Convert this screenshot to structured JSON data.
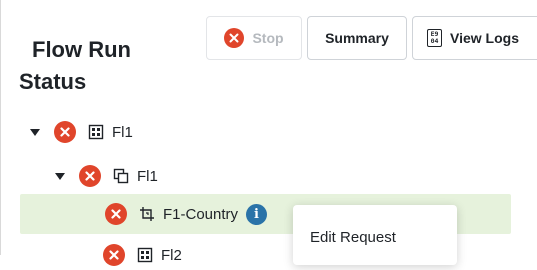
{
  "panel": {
    "title_line1": "Flow Run",
    "title_line2": "Status"
  },
  "toolbar": {
    "stop_label": "Stop",
    "summary_label": "Summary",
    "view_logs_label": "View Logs",
    "log_icon_text_top": "E9",
    "log_icon_text_bottom": "04"
  },
  "tree": {
    "nodes": [
      {
        "label": "Fl1",
        "icon": "grid-icon",
        "status": "error",
        "expanded": true
      },
      {
        "label": "Fl1",
        "icon": "copy-icon",
        "status": "error",
        "expanded": true
      },
      {
        "label": "F1-Country",
        "icon": "crop-icon",
        "status": "error",
        "selected": true,
        "info": "i"
      },
      {
        "label": "Fl2",
        "icon": "grid-icon",
        "status": "error"
      }
    ]
  },
  "context_menu": {
    "items": [
      {
        "label": "Edit Request"
      }
    ]
  },
  "colors": {
    "error": "#e0452b",
    "info": "#2a73a8",
    "selected_row": "#e6f2dc"
  }
}
